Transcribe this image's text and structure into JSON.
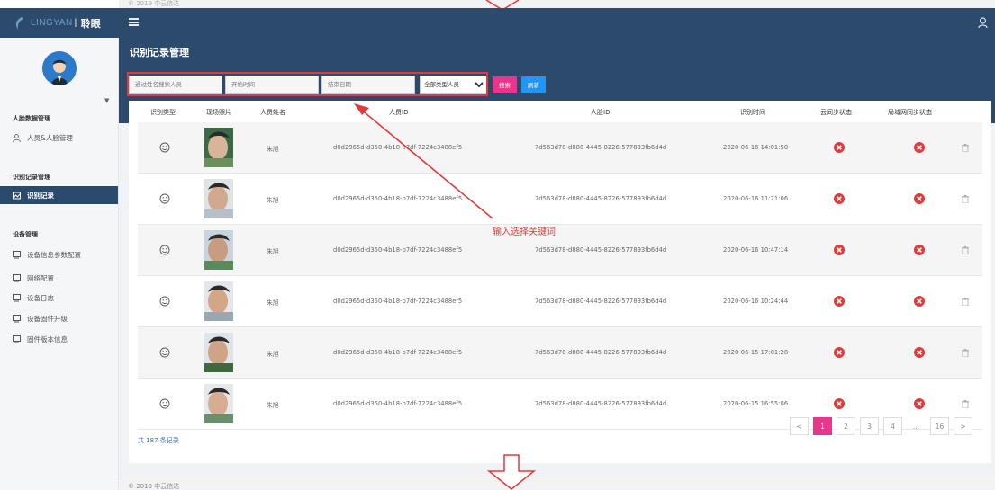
{
  "app": {
    "logo_text": "LINGYAN",
    "logo_cn": "聆眼",
    "copyright": "© 2019 中云信达"
  },
  "sidebar": {
    "groups": [
      {
        "title": "人脸数据管理",
        "items": [
          {
            "label": "人员&人脸管理",
            "icon": "person-icon"
          }
        ]
      },
      {
        "title": "识别记录管理",
        "items": [
          {
            "label": "识别记录",
            "icon": "image-icon",
            "active": true
          }
        ]
      },
      {
        "title": "设备管理",
        "items": [
          {
            "label": "设备信息参数配置",
            "icon": "monitor-icon"
          },
          {
            "label": "网络配置",
            "icon": "monitor-icon"
          },
          {
            "label": "设备日志",
            "icon": "monitor-icon"
          },
          {
            "label": "设备固件升级",
            "icon": "monitor-icon"
          },
          {
            "label": "固件版本信息",
            "icon": "monitor-icon"
          }
        ]
      }
    ]
  },
  "main": {
    "title": "识别记录管理",
    "filters": {
      "name_placeholder": "通过姓名搜索人员",
      "start_placeholder": "开始时间",
      "end_placeholder": "结束日期",
      "type_selected": "全部类型人员",
      "search_label": "搜索",
      "refresh_label": "刷新"
    },
    "annotation": "输入选择关键词",
    "table": {
      "columns": [
        "识别类型",
        "现场照片",
        "人员姓名",
        "人员ID",
        "人脸ID",
        "识别时间",
        "云同步状态",
        "局域网同步状态"
      ],
      "rows": [
        {
          "name": "朱旭",
          "person_id": "d0d2965d-d350-4b18-b7df-7224c3488ef5",
          "face_id": "7d563d78-d880-4445-8226-577893fb6d4d",
          "time": "2020-06-16 14:01:50"
        },
        {
          "name": "朱旭",
          "person_id": "d0d2965d-d350-4b18-b7df-7224c3488ef5",
          "face_id": "7d563d78-d880-4445-8226-577893fb6d4d",
          "time": "2020-06-16 11:21:06"
        },
        {
          "name": "朱旭",
          "person_id": "d0d2965d-d350-4b18-b7df-7224c3488ef5",
          "face_id": "7d563d78-d880-4445-8226-577893fb6d4d",
          "time": "2020-06-16 10:47:14"
        },
        {
          "name": "朱旭",
          "person_id": "d0d2965d-d350-4b18-b7df-7224c3488ef5",
          "face_id": "7d563d78-d880-4445-8226-577893fb6d4d",
          "time": "2020-06-16 10:24:44"
        },
        {
          "name": "朱旭",
          "person_id": "d0d2965d-d350-4b18-b7df-7224c3488ef5",
          "face_id": "7d563d78-d880-4445-8226-577893fb6d4d",
          "time": "2020-06-15 17:01:28"
        },
        {
          "name": "朱旭",
          "person_id": "d0d2965d-d350-4b18-b7df-7224c3488ef5",
          "face_id": "7d563d78-d880-4445-8226-577893fb6d4d",
          "time": "2020-06-15 16:55:06"
        }
      ]
    },
    "total_text": "共 187 条记录",
    "pagination": {
      "prev": "<",
      "pages": [
        "1",
        "2",
        "3",
        "4",
        "...",
        "16"
      ],
      "next": ">",
      "current": "1"
    }
  },
  "colors": {
    "header": "#2c4a6c",
    "accent_pink": "#e8378a",
    "accent_blue": "#2196f3",
    "error_red": "#e23a3a"
  }
}
